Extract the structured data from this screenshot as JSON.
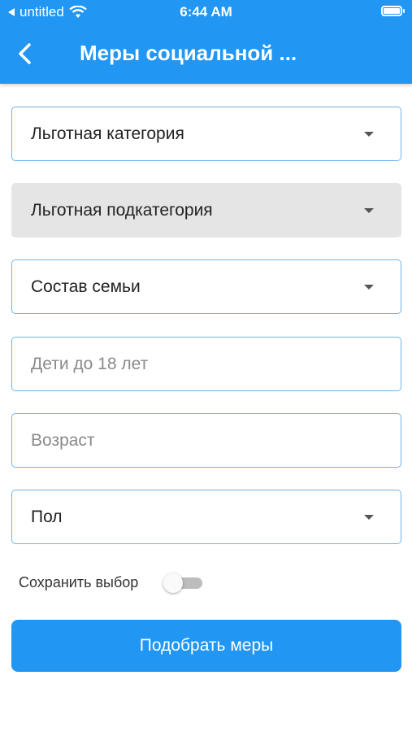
{
  "status_bar": {
    "carrier": "untitled",
    "time": "6:44 AM"
  },
  "header": {
    "title": "Меры социальной ..."
  },
  "form": {
    "benefit_category": {
      "label": "Льготная категория"
    },
    "benefit_subcategory": {
      "label": "Льготная подкатегория"
    },
    "family_composition": {
      "label": "Состав семьи"
    },
    "children_under_18": {
      "placeholder": "Дети до 18 лет"
    },
    "age": {
      "placeholder": "Возраст"
    },
    "gender": {
      "label": "Пол"
    },
    "save_choice": {
      "label": "Сохранить выбор",
      "enabled": false
    },
    "submit_label": "Подобрать меры"
  },
  "colors": {
    "primary": "#2196F3",
    "field_border": "#6fb4ea",
    "disabled_fill": "#e5e5e5"
  },
  "icons": [
    "signal-back-icon",
    "wifi-icon",
    "battery-icon",
    "back-chevron-icon",
    "dropdown-arrow-icon"
  ]
}
